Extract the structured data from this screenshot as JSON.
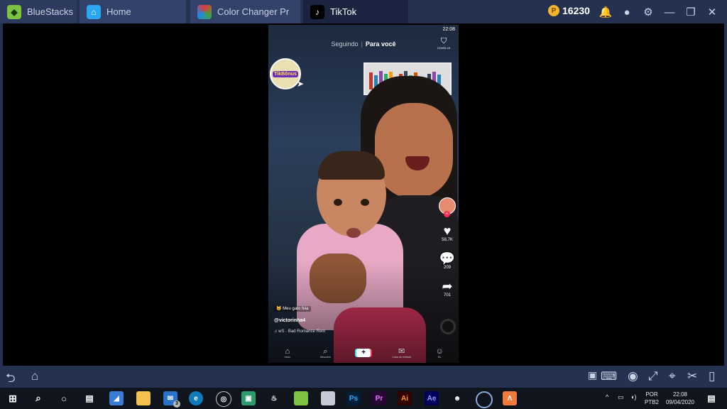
{
  "titlebar": {
    "tabs": [
      {
        "label": "BlueStacks",
        "icon": "bluestacks-logo-icon"
      },
      {
        "label": "Home",
        "icon": "home-icon"
      },
      {
        "label": "Color Changer Pr",
        "icon": "color-changer-app-icon"
      },
      {
        "label": "TikTok",
        "icon": "tiktok-icon"
      }
    ],
    "coins": "16230",
    "colors": {
      "bar": "#243151",
      "active_tab": "#1a2440"
    }
  },
  "phone": {
    "time": "22:08",
    "topnav": {
      "following": "Seguindo",
      "for_you": "Para você"
    },
    "covid_label": "COVID-19",
    "badge_text": "TikBônus",
    "likes": "58,7K",
    "comments": "209",
    "shares": "701",
    "caption": "Meu gato feia",
    "username": "@victorinha4",
    "music": "wS · Bad Romance Rem",
    "nav": {
      "home": "Início",
      "discover": "Descobrir",
      "inbox": "Caixa de entrada",
      "me": "Eu"
    }
  },
  "taskbar": {
    "mail_badge": "3",
    "apps": [
      "Ps",
      "Pr",
      "Ai",
      "Ae"
    ],
    "language": "POR",
    "layout": "PTB2",
    "time": "22:08",
    "date": "09/04/2020"
  }
}
